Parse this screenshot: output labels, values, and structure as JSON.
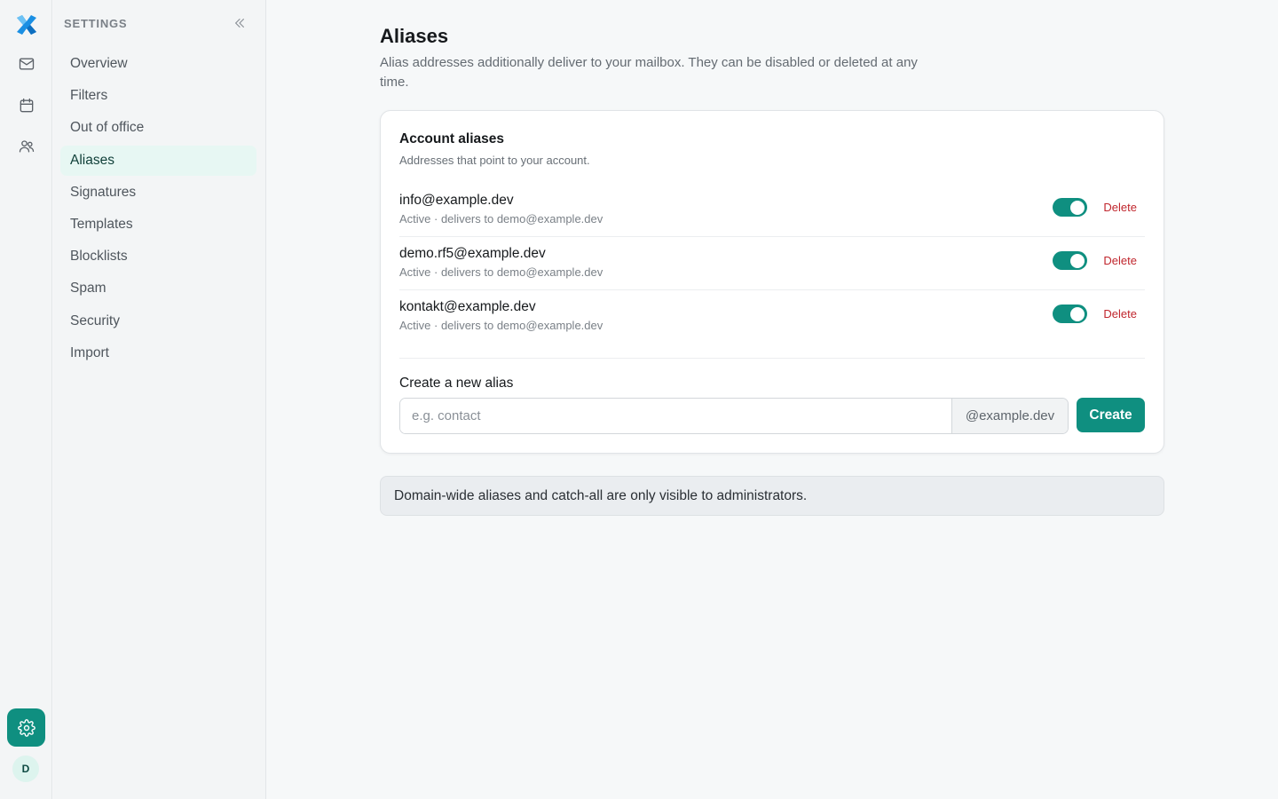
{
  "rail": {
    "icons": [
      "logo-icon",
      "mail-icon",
      "calendar-icon",
      "contacts-icon",
      "settings-icon"
    ],
    "avatar_initial": "D",
    "accent": "#0f8f80"
  },
  "sidebar": {
    "title": "SETTINGS",
    "items": [
      {
        "label": "Overview"
      },
      {
        "label": "Filters"
      },
      {
        "label": "Out of office"
      },
      {
        "label": "Aliases"
      },
      {
        "label": "Signatures"
      },
      {
        "label": "Templates"
      },
      {
        "label": "Blocklists"
      },
      {
        "label": "Spam"
      },
      {
        "label": "Security"
      },
      {
        "label": "Import"
      }
    ],
    "active": "Aliases"
  },
  "page": {
    "title": "Aliases",
    "description": "Alias addresses additionally deliver to your mailbox. They can be disabled or deleted at any time."
  },
  "account_aliases": {
    "title": "Account aliases",
    "subtitle": "Addresses that point to your account.",
    "rows": [
      {
        "email": "info@example.dev",
        "status": "Active · delivers to demo@example.dev",
        "enabled": true,
        "delete_label": "Delete"
      },
      {
        "email": "demo.rf5@example.dev",
        "status": "Active · delivers to demo@example.dev",
        "enabled": true,
        "delete_label": "Delete"
      },
      {
        "email": "kontakt@example.dev",
        "status": "Active · delivers to demo@example.dev",
        "enabled": true,
        "delete_label": "Delete"
      }
    ]
  },
  "create": {
    "label": "Create a new alias",
    "placeholder": "e.g. contact",
    "value": "",
    "domain_suffix": "@example.dev",
    "button_label": "Create"
  },
  "notice": {
    "text": "Domain-wide aliases and catch-all are only visible to administrators."
  },
  "colors": {
    "accent": "#0f8f80",
    "danger": "#c0262d",
    "active_nav_bg": "#e7f7f3"
  }
}
